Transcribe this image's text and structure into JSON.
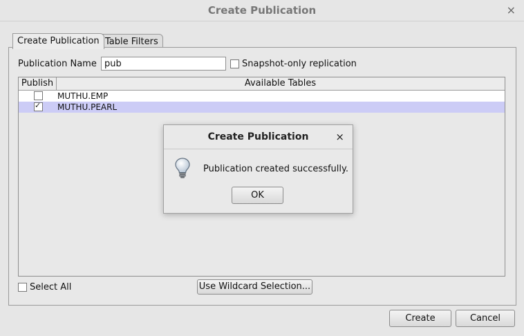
{
  "window": {
    "title": "Create Publication",
    "close_glyph": "×"
  },
  "tabs": [
    {
      "label": "Create Publication",
      "active": true
    },
    {
      "label": "Table Filters",
      "active": false
    }
  ],
  "form": {
    "name_label": "Publication Name",
    "name_value": "pub",
    "snapshot_label": "Snapshot-only replication",
    "snapshot_checked": false
  },
  "table": {
    "headers": [
      "Publish",
      "Available Tables"
    ],
    "rows": [
      {
        "publish": false,
        "name": "MUTHU.EMP"
      },
      {
        "publish": true,
        "name": "MUTHU.PEARL",
        "selected": true
      }
    ]
  },
  "footer": {
    "select_all_label": "Select All",
    "wildcard_label": "Use Wildcard Selection...",
    "create_label": "Create",
    "cancel_label": "Cancel"
  },
  "dialog": {
    "title": "Create Publication",
    "close_glyph": "×",
    "message": "Publication created successfully.",
    "ok_label": "OK",
    "icon": "lightbulb-icon"
  }
}
